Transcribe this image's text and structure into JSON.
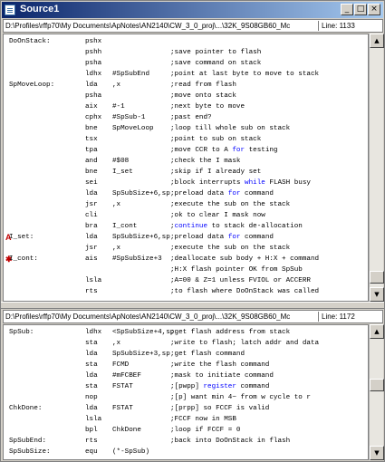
{
  "window": {
    "title": "Source1",
    "minimize_glyph": "_",
    "maximize_glyph": "□",
    "close_glyph": "×"
  },
  "top_pane": {
    "path": "D:\\Profiles\\rffp70\\My Documents\\ApNotes\\AN2140\\CW_3_0_proj\\...\\32K_9S08GB60_Mc",
    "line_indicator": "Line: 1133",
    "lines": [
      {
        "label": "DoOnStack:",
        "op": "pshx",
        "arg": "",
        "comment": "",
        "marker": ""
      },
      {
        "label": "",
        "op": "pshh",
        "arg": "",
        "comment": ";save pointer to flash",
        "marker": ""
      },
      {
        "label": "",
        "op": "psha",
        "arg": "",
        "comment": ";save command on stack",
        "marker": ""
      },
      {
        "label": "",
        "op": "ldhx",
        "arg": "#SpSubEnd",
        "comment": ";point at last byte to move to stack",
        "marker": ""
      },
      {
        "label": "SpMoveLoop:",
        "op": "lda",
        "arg": ",x",
        "comment": ";read from flash",
        "marker": ""
      },
      {
        "label": "",
        "op": "psha",
        "arg": "",
        "comment": ";move onto stack",
        "marker": ""
      },
      {
        "label": "",
        "op": "aix",
        "arg": "#-1",
        "comment": ";next byte to move",
        "marker": ""
      },
      {
        "label": "",
        "op": "cphx",
        "arg": "#SpSub-1",
        "comment": ";past end?",
        "marker": ""
      },
      {
        "label": "",
        "op": "bne",
        "arg": "SpMoveLoop",
        "comment": ";loop till whole sub on stack",
        "marker": ""
      },
      {
        "label": "",
        "op": "tsx",
        "arg": "",
        "comment": ";point to sub on stack",
        "marker": ""
      },
      {
        "label": "",
        "op": "tpa",
        "arg": "",
        "comment": ";move CCR to A for testing",
        "marker": ""
      },
      {
        "label": "",
        "op": "and",
        "arg": "#$08",
        "comment": ";check the I mask",
        "marker": ""
      },
      {
        "label": "",
        "op": "bne",
        "arg": "I_set",
        "comment": ";skip if I already set",
        "marker": ""
      },
      {
        "label": "",
        "op": "sei",
        "arg": "",
        "comment": ";block interrupts while FLASH busy",
        "marker": ""
      },
      {
        "label": "",
        "op": "lda",
        "arg": "SpSubSize+6,sp",
        "comment": ";preload data for command",
        "marker": ""
      },
      {
        "label": "",
        "op": "jsr",
        "arg": ",x",
        "comment": ";execute the sub on the stack",
        "marker": ""
      },
      {
        "label": "",
        "op": "cli",
        "arg": "",
        "comment": ";ok to clear I mask now",
        "marker": ""
      },
      {
        "label": "",
        "op": "bra",
        "arg": "I_cont",
        "comment": ";continue to stack de-allocation",
        "marker": ""
      },
      {
        "label": "I_set:",
        "op": "lda",
        "arg": "SpSubSize+6,sp",
        "comment": ";preload data for command",
        "marker": "A"
      },
      {
        "label": "",
        "op": "jsr",
        "arg": ",x",
        "comment": ";execute the sub on the stack",
        "marker": ""
      },
      {
        "label": "I_cont:",
        "op": "ais",
        "arg": "#SpSubSize+3",
        "comment": ";deallocate sub body + H:X + command",
        "marker": "✱"
      },
      {
        "label": "",
        "op": "",
        "arg": "",
        "comment": ";H:X flash pointer OK from SpSub",
        "marker": ""
      },
      {
        "label": "",
        "op": "lsla",
        "arg": "",
        "comment": ";A=00 & Z=1 unless FVIOL or ACCERR",
        "marker": ""
      },
      {
        "label": "",
        "op": "rts",
        "arg": "",
        "comment": ";to flash where DoOnStack was called",
        "marker": ""
      }
    ]
  },
  "bottom_pane": {
    "path": "D:\\Profiles\\rffp70\\My Documents\\ApNotes\\AN2140\\CW_3_0_proj\\...\\32K_9S08GB60_Mc",
    "line_indicator": "Line: 1172",
    "lines": [
      {
        "label": "SpSub:",
        "op": "ldhx",
        "arg": "<SpSubSize+4,sp",
        "comment": ";get flash address from stack"
      },
      {
        "label": "",
        "op": "sta",
        "arg": ",x",
        "comment": ";write to flash; latch addr and data"
      },
      {
        "label": "",
        "op": "lda",
        "arg": "SpSubSize+3,sp",
        "comment": ";get flash command"
      },
      {
        "label": "",
        "op": "sta",
        "arg": "FCMD",
        "comment": ";write the flash command"
      },
      {
        "label": "",
        "op": "lda",
        "arg": "#mFCBEF",
        "comment": ";mask to initiate command"
      },
      {
        "label": "",
        "op": "sta",
        "arg": "FSTAT",
        "comment": ";[pwpp] register command"
      },
      {
        "label": "",
        "op": "nop",
        "arg": "",
        "comment": ";[p] want min 4~ from w cycle to r"
      },
      {
        "label": "ChkDone:",
        "op": "lda",
        "arg": "FSTAT",
        "comment": ";[prpp] so FCCF is valid"
      },
      {
        "label": "",
        "op": "lsla",
        "arg": "",
        "comment": ";FCCF now in MSB"
      },
      {
        "label": "",
        "op": "bpl",
        "arg": "ChkDone",
        "comment": ";loop if FCCF = 0"
      },
      {
        "label": "SpSubEnd:",
        "op": "rts",
        "arg": "",
        "comment": ";back into DoOnStack in flash"
      },
      {
        "label": "SpSubSize:",
        "op": "equ",
        "arg": "(*-SpSub)",
        "comment": ""
      }
    ]
  },
  "scroll": {
    "up_glyph": "▲",
    "down_glyph": "▼"
  }
}
